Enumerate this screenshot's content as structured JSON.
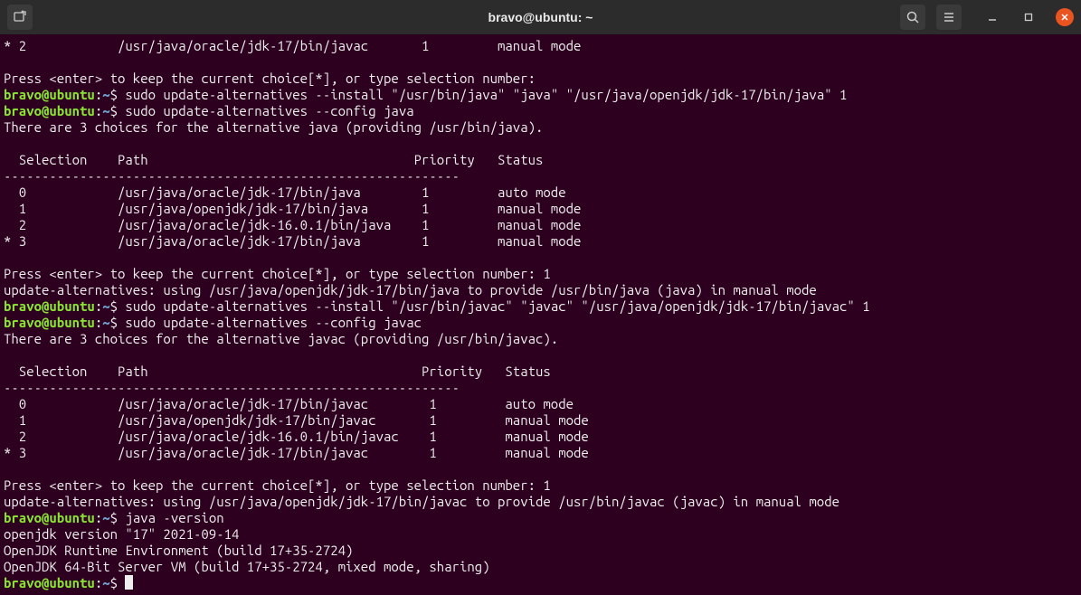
{
  "titlebar": {
    "title": "bravo@ubuntu: ~"
  },
  "prompt": {
    "userhost": "bravo@ubuntu",
    "colon": ":",
    "path": "~",
    "dollar": "$"
  },
  "lines": {
    "l1": "* 2            /usr/java/oracle/jdk-17/bin/javac       1         manual mode",
    "l2": "",
    "l3": "Press <enter> to keep the current choice[*], or type selection number:",
    "cmd1": " sudo update-alternatives --install \"/usr/bin/java\" \"java\" \"/usr/java/openjdk/jdk-17/bin/java\" 1",
    "cmd2": " sudo update-alternatives --config java",
    "l6": "There are 3 choices for the alternative java (providing /usr/bin/java).",
    "l7": "",
    "l8": "  Selection    Path                                   Priority   Status",
    "l9": "------------------------------------------------------------",
    "l10": "  0            /usr/java/oracle/jdk-17/bin/java        1         auto mode",
    "l11": "  1            /usr/java/openjdk/jdk-17/bin/java       1         manual mode",
    "l12": "  2            /usr/java/oracle/jdk-16.0.1/bin/java    1         manual mode",
    "l13": "* 3            /usr/java/oracle/jdk-17/bin/java        1         manual mode",
    "l14": "",
    "l15": "Press <enter> to keep the current choice[*], or type selection number: 1",
    "l16": "update-alternatives: using /usr/java/openjdk/jdk-17/bin/java to provide /usr/bin/java (java) in manual mode",
    "cmd3": " sudo update-alternatives --install \"/usr/bin/javac\" \"javac\" \"/usr/java/openjdk/jdk-17/bin/javac\" 1",
    "cmd4": " sudo update-alternatives --config javac",
    "l19": "There are 3 choices for the alternative javac (providing /usr/bin/javac).",
    "l20": "",
    "l21": "  Selection    Path                                    Priority   Status",
    "l22": "------------------------------------------------------------",
    "l23": "  0            /usr/java/oracle/jdk-17/bin/javac        1         auto mode",
    "l24": "  1            /usr/java/openjdk/jdk-17/bin/javac       1         manual mode",
    "l25": "  2            /usr/java/oracle/jdk-16.0.1/bin/javac    1         manual mode",
    "l26": "* 3            /usr/java/oracle/jdk-17/bin/javac        1         manual mode",
    "l27": "",
    "l28": "Press <enter> to keep the current choice[*], or type selection number: 1",
    "l29": "update-alternatives: using /usr/java/openjdk/jdk-17/bin/javac to provide /usr/bin/javac (javac) in manual mode",
    "cmd5": " java -version",
    "l31": "openjdk version \"17\" 2021-09-14",
    "l32": "OpenJDK Runtime Environment (build 17+35-2724)",
    "l33": "OpenJDK 64-Bit Server VM (build 17+35-2724, mixed mode, sharing)"
  }
}
